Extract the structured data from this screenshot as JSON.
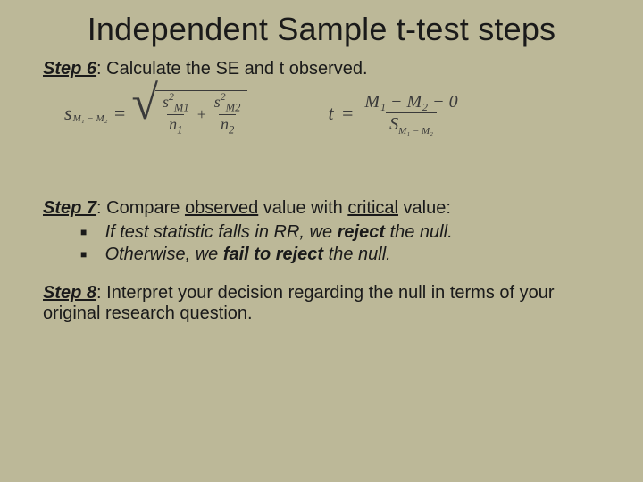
{
  "title": "Independent Sample t-test steps",
  "step6": {
    "label": "Step 6",
    "text": ": Calculate the SE and t observed."
  },
  "se": {
    "lhs_s": "s",
    "lhs_sub": "M₁ − M₂",
    "eq": "=",
    "num1_top": "s",
    "num1_sup": "2",
    "num1_sub": "M1",
    "den1": "n",
    "den1_sub": "1",
    "plus": "+",
    "num2_top": "s",
    "num2_sup": "2",
    "num2_sub": "M2",
    "den2": "n",
    "den2_sub": "2"
  },
  "t": {
    "lhs": "t",
    "eq": "=",
    "num": "M₁ − M₂ − 0",
    "den_S": "S",
    "den_sub": "M₁ − M₂"
  },
  "step7": {
    "label": "Step 7",
    "lead_a": ": Compare ",
    "u1": "observed",
    "lead_b": " value with ",
    "u2": "critical",
    "lead_c": " value:",
    "b1_a": "If test statistic falls in RR, we ",
    "b1_r": "reject",
    "b1_b": " the null.",
    "b2_a": "Otherwise, we ",
    "b2_r": "fail to reject",
    "b2_b": " the null."
  },
  "step8": {
    "label": "Step 8",
    "text": ": Interpret your decision regarding the null in terms of your original research question."
  }
}
